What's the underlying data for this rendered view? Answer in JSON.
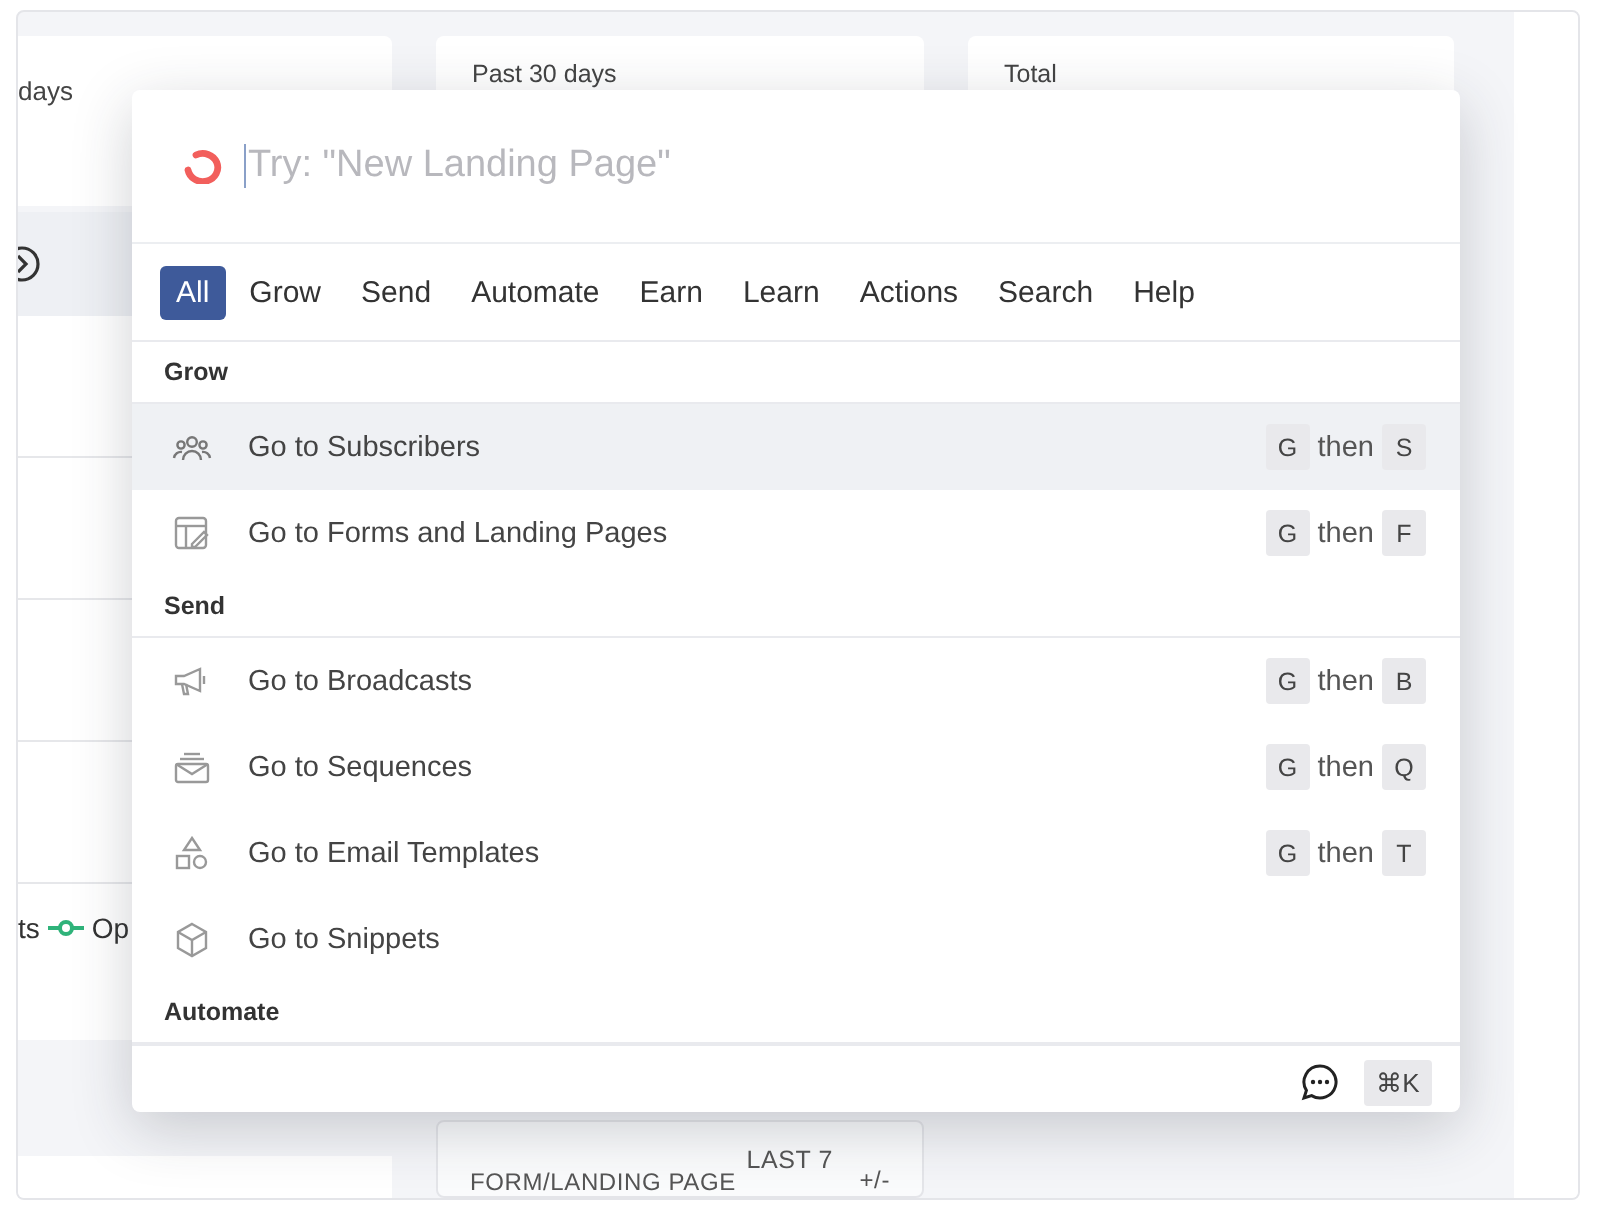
{
  "background": {
    "stat_cards": [
      {
        "label": "days"
      },
      {
        "label": "Past 30 days"
      },
      {
        "label": "Total"
      }
    ],
    "legend": {
      "cut_label": "ts",
      "series": [
        {
          "label": "Op",
          "color": "#2fb37a"
        }
      ]
    },
    "table": {
      "columns": [
        "FORM/LANDING PAGE",
        "LAST 7",
        "+/-"
      ]
    }
  },
  "palette": {
    "placeholder": "Try: \"New Landing Page\"",
    "tabs": [
      {
        "label": "All",
        "selected": true
      },
      {
        "label": "Grow",
        "selected": false
      },
      {
        "label": "Send",
        "selected": false
      },
      {
        "label": "Automate",
        "selected": false
      },
      {
        "label": "Earn",
        "selected": false
      },
      {
        "label": "Learn",
        "selected": false
      },
      {
        "label": "Actions",
        "selected": false
      },
      {
        "label": "Search",
        "selected": false
      },
      {
        "label": "Help",
        "selected": false
      }
    ],
    "sections": [
      {
        "title": "Grow",
        "items": [
          {
            "kind": "people",
            "label": "Go to Subscribers",
            "selected": true,
            "shortcut": {
              "first": "G",
              "joiner": "then",
              "second": "S"
            }
          },
          {
            "kind": "form",
            "label": "Go to Forms and Landing Pages",
            "selected": false,
            "shortcut": {
              "first": "G",
              "joiner": "then",
              "second": "F"
            }
          }
        ]
      },
      {
        "title": "Send",
        "items": [
          {
            "kind": "megaphone",
            "label": "Go to Broadcasts",
            "selected": false,
            "shortcut": {
              "first": "G",
              "joiner": "then",
              "second": "B"
            }
          },
          {
            "kind": "envelope",
            "label": "Go to Sequences",
            "selected": false,
            "shortcut": {
              "first": "G",
              "joiner": "then",
              "second": "Q"
            }
          },
          {
            "kind": "shapes",
            "label": "Go to Email Templates",
            "selected": false,
            "shortcut": {
              "first": "G",
              "joiner": "then",
              "second": "T"
            }
          },
          {
            "kind": "cube",
            "label": "Go to Snippets",
            "selected": false
          }
        ]
      },
      {
        "title": "Automate"
      }
    ],
    "footer": {
      "shortcut": "⌘K"
    }
  }
}
